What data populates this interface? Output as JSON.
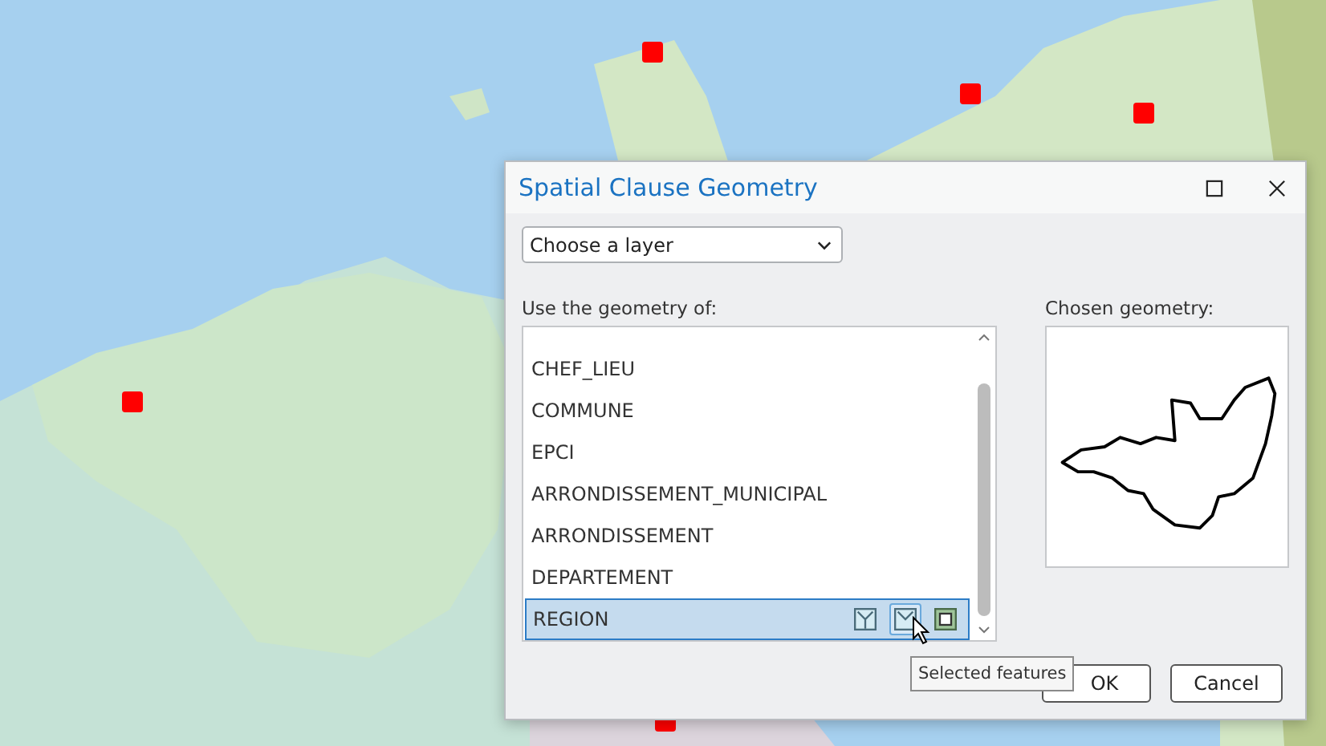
{
  "dialog": {
    "title": "Spatial Clause Geometry",
    "layer_dropdown": {
      "value": "Choose a layer"
    },
    "list_label": "Use the geometry of:",
    "layers": [
      {
        "name": "CHEF_LIEU",
        "selected": false
      },
      {
        "name": "COMMUNE",
        "selected": false
      },
      {
        "name": "EPCI",
        "selected": false
      },
      {
        "name": "ARRONDISSEMENT_MUNICIPAL",
        "selected": false
      },
      {
        "name": "ARRONDISSEMENT",
        "selected": false
      },
      {
        "name": "DEPARTEMENT",
        "selected": false
      },
      {
        "name": "REGION",
        "selected": true
      }
    ],
    "row_tools": [
      {
        "kind": "all",
        "selected": false
      },
      {
        "kind": "selection",
        "selected": true
      },
      {
        "kind": "extent",
        "selected": false
      }
    ],
    "preview_label": "Chosen geometry:",
    "tooltip": "Selected features",
    "buttons": [
      "OK",
      "Cancel"
    ]
  }
}
